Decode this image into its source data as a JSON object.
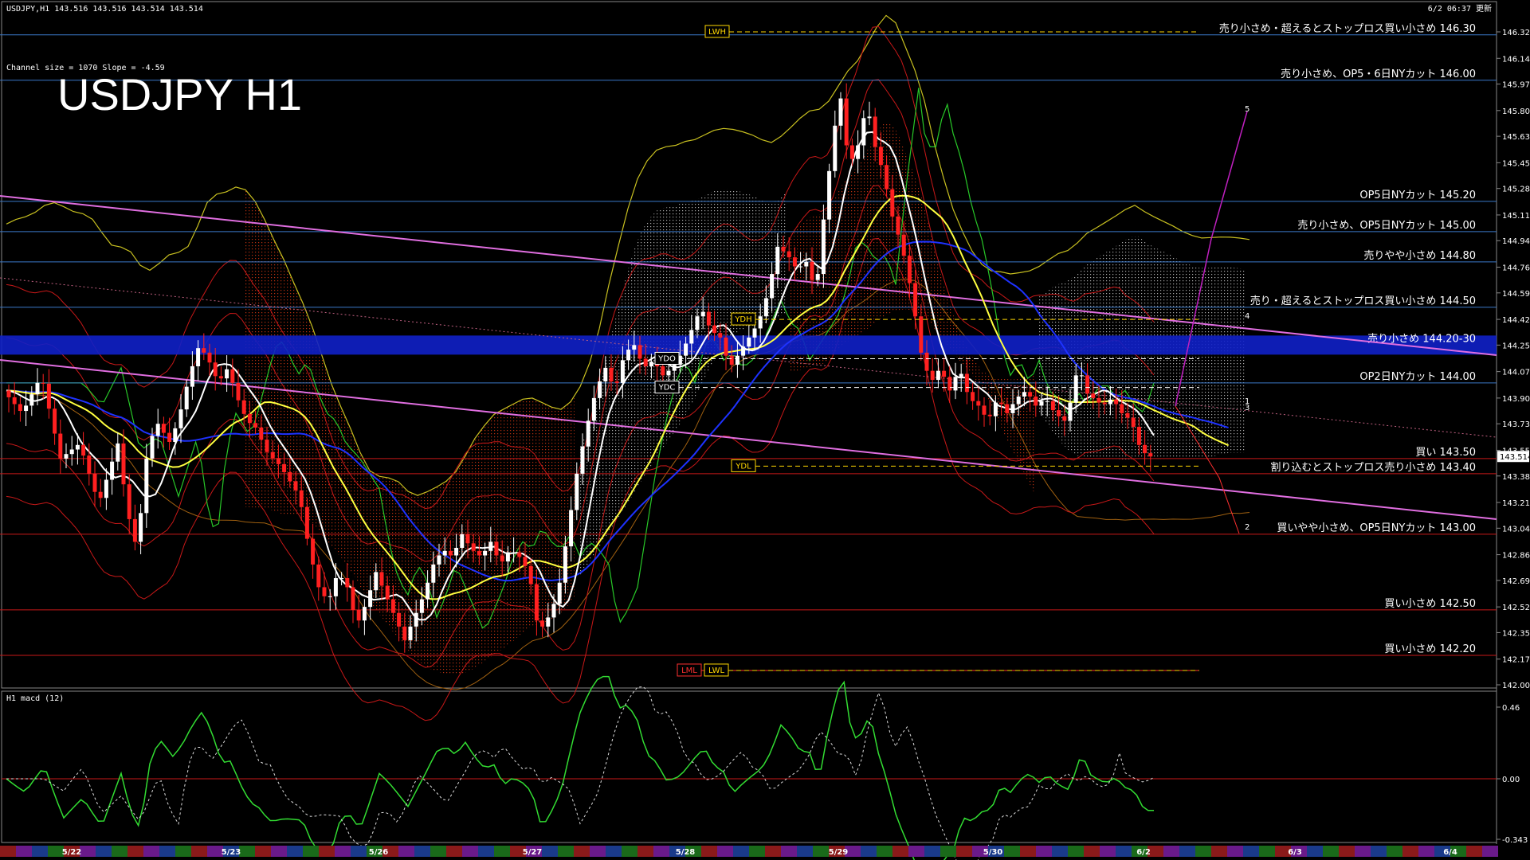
{
  "header": {
    "symbol_info": "USDJPY,H1  143.516 143.516 143.514 143.514",
    "timestamp": "6/2 06:37 更新",
    "channel_info": "Channel size = 1070 Slope = -4.59",
    "big_title": "USDJPY H1",
    "macd_label": "H1  macd (12)"
  },
  "colors": {
    "background": "#000000",
    "level_line": "#3a78c8",
    "red_line": "#c81818",
    "channel_pink": "#e06ee0",
    "ma_white": "#ffffff",
    "ma_yellow": "#ffff40",
    "ma_blue": "#1e32ff",
    "chikou_green": "#28c828",
    "cloud_red": "#a02800",
    "cloud_white": "#c8c8c8",
    "bull_candle": "#ffffff",
    "bear_candle": "#ff2020",
    "macd_green": "#32dc32",
    "macd_pink": "#ff8ca0"
  },
  "price_axis": {
    "ticks": [
      "146.320",
      "146.145",
      "145.975",
      "145.800",
      "145.630",
      "145.455",
      "145.285",
      "145.110",
      "144.940",
      "144.765",
      "144.595",
      "144.420",
      "144.250",
      "144.075",
      "143.900",
      "143.730",
      "143.555",
      "143.385",
      "143.210",
      "143.040",
      "142.865",
      "142.695",
      "142.520",
      "142.350",
      "142.175",
      "142.005"
    ],
    "current_price": "143.514"
  },
  "macd_axis": {
    "ticks": [
      "0.46",
      "0.00",
      "-0.343"
    ]
  },
  "levels": [
    {
      "price": 146.3,
      "label": "売り小さめ・超えるとストップロス買い小さめ 146.30",
      "color": "blue"
    },
    {
      "price": 146.0,
      "label": "売り小さめ、OP5・6日NYカット 146.00",
      "color": "blue"
    },
    {
      "price": 145.2,
      "label": "OP5日NYカット 145.20",
      "color": "blue"
    },
    {
      "price": 145.0,
      "label": "売り小さめ、OP5日NYカット 145.00",
      "color": "blue"
    },
    {
      "price": 144.8,
      "label": "売りやや小さめ 144.80",
      "color": "blue"
    },
    {
      "price": 144.5,
      "label": "売り・超えるとストップロス買い小さめ 144.50",
      "color": "blue"
    },
    {
      "price": 144.25,
      "label": "売り小さめ 144.20-30",
      "color": "band"
    },
    {
      "price": 144.0,
      "label": "OP2日NYカット 144.00",
      "color": "blue"
    },
    {
      "price": 143.5,
      "label": "買い 143.50",
      "color": "red"
    },
    {
      "price": 143.4,
      "label": "割り込むとストップロス売り小さめ 143.40",
      "color": "red"
    },
    {
      "price": 143.0,
      "label": "買いやや小さめ、OP5日NYカット 143.00",
      "color": "red"
    },
    {
      "price": 142.5,
      "label": "買い小さめ 142.50",
      "color": "red"
    },
    {
      "price": 142.2,
      "label": "買い小さめ 142.20",
      "color": "red"
    }
  ],
  "markers": [
    {
      "text": "LWH",
      "price": 146.32,
      "pos": "a"
    },
    {
      "text": "YDH",
      "price": 144.42,
      "pos": "b"
    },
    {
      "text": "YDO",
      "price": 144.16,
      "pos": "c"
    },
    {
      "text": "YDC",
      "price": 143.97,
      "pos": "d"
    },
    {
      "text": "YDL",
      "price": 143.45,
      "pos": "e"
    },
    {
      "text": "LML",
      "price": 142.1,
      "pos": "f"
    },
    {
      "text": "LWL",
      "price": 142.1,
      "pos": "g"
    }
  ],
  "wave_labels": [
    "5",
    "4",
    "1",
    "3",
    "2"
  ],
  "date_axis": [
    "5/22",
    "5/23",
    "5/26",
    "5/27",
    "5/28",
    "5/29",
    "5/30",
    "6/2",
    "6/3",
    "6/4"
  ],
  "chart_data": {
    "type": "line",
    "title": "USDJPY H1",
    "x": [
      "5/22",
      "5/23",
      "5/26",
      "5/27",
      "5/28",
      "5/29",
      "5/30",
      "6/2"
    ],
    "ylim": [
      142.005,
      146.32
    ],
    "series": [
      {
        "name": "USDJPY",
        "values": [
          143.7,
          143.95,
          142.8,
          142.6,
          144.2,
          145.9,
          144.0,
          143.514
        ]
      }
    ],
    "price_path": [
      [
        0,
        143.95
      ],
      [
        20,
        143.8
      ],
      [
        40,
        144.05
      ],
      [
        60,
        143.5
      ],
      [
        80,
        143.6
      ],
      [
        100,
        143.2
      ],
      [
        120,
        143.6
      ],
      [
        130,
        143.15
      ],
      [
        140,
        142.9
      ],
      [
        150,
        143.5
      ],
      [
        160,
        143.75
      ],
      [
        175,
        143.6
      ],
      [
        185,
        143.8
      ],
      [
        195,
        144.05
      ],
      [
        205,
        144.25
      ],
      [
        215,
        144.15
      ],
      [
        225,
        144.0
      ],
      [
        235,
        144.1
      ],
      [
        245,
        143.9
      ],
      [
        255,
        143.75
      ],
      [
        265,
        143.7
      ],
      [
        275,
        143.55
      ],
      [
        290,
        143.45
      ],
      [
        300,
        143.35
      ],
      [
        310,
        143.25
      ],
      [
        320,
        142.9
      ],
      [
        330,
        142.65
      ],
      [
        340,
        142.55
      ],
      [
        350,
        142.75
      ],
      [
        360,
        142.65
      ],
      [
        370,
        142.4
      ],
      [
        380,
        142.55
      ],
      [
        390,
        142.75
      ],
      [
        400,
        142.6
      ],
      [
        410,
        142.45
      ],
      [
        420,
        142.3
      ],
      [
        430,
        142.45
      ],
      [
        440,
        142.6
      ],
      [
        450,
        142.8
      ],
      [
        460,
        142.9
      ],
      [
        470,
        142.85
      ],
      [
        480,
        143.0
      ],
      [
        490,
        142.9
      ],
      [
        500,
        142.85
      ],
      [
        510,
        142.95
      ],
      [
        520,
        142.8
      ],
      [
        530,
        142.9
      ],
      [
        540,
        142.85
      ],
      [
        550,
        142.75
      ],
      [
        560,
        142.35
      ],
      [
        570,
        142.45
      ],
      [
        580,
        142.6
      ],
      [
        590,
        143.0
      ],
      [
        600,
        143.4
      ],
      [
        610,
        143.7
      ],
      [
        620,
        143.95
      ],
      [
        630,
        144.1
      ],
      [
        640,
        143.95
      ],
      [
        650,
        144.2
      ],
      [
        660,
        144.25
      ],
      [
        670,
        144.1
      ],
      [
        680,
        144.15
      ],
      [
        690,
        144.05
      ],
      [
        700,
        144.1
      ],
      [
        710,
        144.2
      ],
      [
        720,
        144.35
      ],
      [
        730,
        144.5
      ],
      [
        740,
        144.35
      ],
      [
        750,
        144.3
      ],
      [
        760,
        144.1
      ],
      [
        770,
        144.2
      ],
      [
        780,
        144.3
      ],
      [
        790,
        144.4
      ],
      [
        800,
        144.6
      ],
      [
        810,
        144.9
      ],
      [
        820,
        144.85
      ],
      [
        830,
        144.75
      ],
      [
        840,
        144.8
      ],
      [
        850,
        144.6
      ],
      [
        860,
        145.2
      ],
      [
        870,
        145.7
      ],
      [
        875,
        145.95
      ],
      [
        880,
        145.6
      ],
      [
        890,
        145.45
      ],
      [
        900,
        145.75
      ],
      [
        905,
        145.8
      ],
      [
        910,
        145.6
      ],
      [
        920,
        145.4
      ],
      [
        930,
        145.1
      ],
      [
        940,
        144.9
      ],
      [
        950,
        144.6
      ],
      [
        960,
        144.2
      ],
      [
        970,
        144.0
      ],
      [
        980,
        144.1
      ],
      [
        990,
        143.95
      ],
      [
        1000,
        144.1
      ],
      [
        1010,
        143.9
      ],
      [
        1020,
        143.85
      ],
      [
        1030,
        143.75
      ],
      [
        1040,
        143.9
      ],
      [
        1050,
        143.8
      ],
      [
        1060,
        143.9
      ],
      [
        1070,
        143.95
      ],
      [
        1080,
        143.85
      ],
      [
        1090,
        143.9
      ],
      [
        1100,
        143.8
      ],
      [
        1110,
        143.75
      ],
      [
        1120,
        143.95
      ],
      [
        1125,
        144.2
      ],
      [
        1130,
        143.95
      ],
      [
        1140,
        143.9
      ],
      [
        1150,
        143.85
      ],
      [
        1160,
        143.9
      ],
      [
        1170,
        143.8
      ],
      [
        1180,
        143.75
      ],
      [
        1190,
        143.55
      ],
      [
        1200,
        143.514
      ]
    ]
  }
}
